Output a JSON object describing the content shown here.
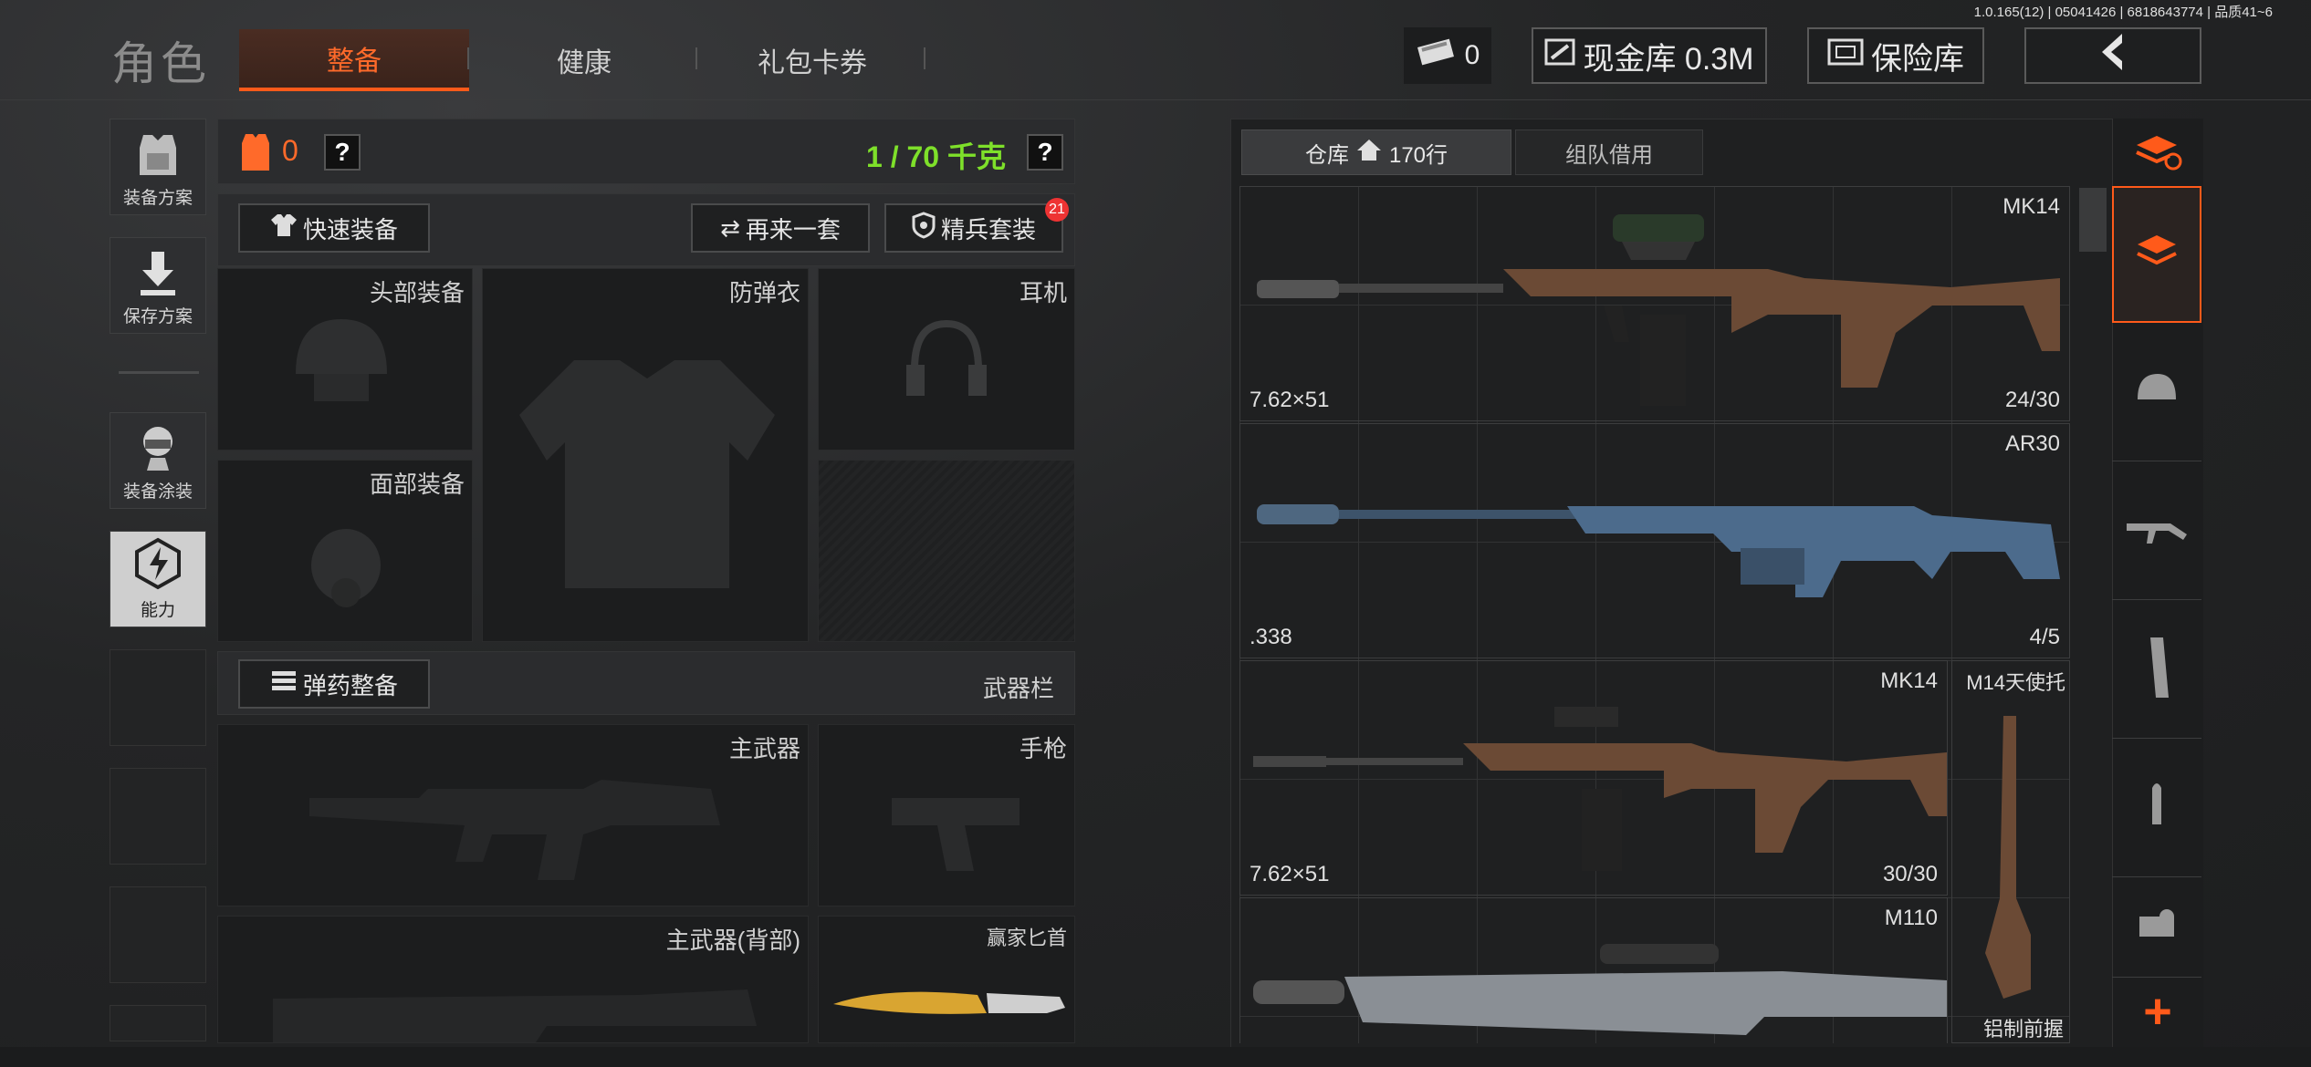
{
  "header": {
    "title": "角色",
    "tabs": [
      "整备",
      "健康",
      "礼包卡券"
    ],
    "active_tab": 0,
    "version": "1.0.165(12) | 05041426 | 6818643774 | 品质41~6",
    "currency_count": "0",
    "cash_vault": "现金库 0.3M",
    "insurance": "保险库"
  },
  "left_menu": {
    "items": [
      {
        "label": "装备方案",
        "icon": "vest-icon"
      },
      {
        "label": "保存方案",
        "icon": "download-icon"
      },
      {
        "label": "装备涂装",
        "icon": "paint-icon"
      },
      {
        "label": "能力",
        "icon": "ability-icon"
      }
    ]
  },
  "loadout": {
    "armor_value": "0",
    "weight": "1 / 70 千克",
    "quick_equip": "快速装备",
    "again_set": "再来一套",
    "elite_set": "精兵套装",
    "elite_badge": "21",
    "slots": {
      "head": "头部装备",
      "vest": "防弹衣",
      "ear": "耳机",
      "face": "面部装备",
      "primary": "主武器",
      "pistol": "手枪",
      "primary_back": "主武器(背部)",
      "knife": "赢家匕首"
    },
    "ammo_btn": "弹药整备",
    "weapon_bar": "武器栏"
  },
  "warehouse": {
    "tab_storage": "仓库",
    "rows": "170行",
    "tab_team": "组队借用",
    "items": [
      {
        "name": "MK14",
        "caliber": "7.62×51",
        "count": "24/30"
      },
      {
        "name": "AR30",
        "caliber": ".338",
        "count": "4/5"
      },
      {
        "name": "MK14",
        "caliber": "7.62×51",
        "count": "30/30"
      },
      {
        "name": "M110",
        "caliber": "",
        "count": ""
      }
    ],
    "side_item": {
      "name": "M14天使托",
      "bottom": "铝制前握"
    }
  },
  "colors": {
    "accent": "#ff5a1a",
    "weight_green": "#7ee02a",
    "armor_orange": "#ff6a2a"
  }
}
